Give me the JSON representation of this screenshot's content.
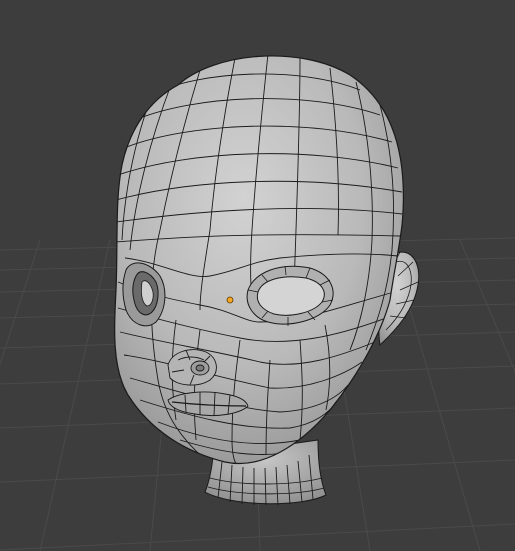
{
  "viewport": {
    "name": "3D Viewport",
    "background_color": "#3d3d3d",
    "grid_color": "#4a4a4a"
  },
  "object": {
    "name": "head-mesh",
    "display": "wireframe-overlay",
    "surface_color": "#bdbdbd",
    "edge_color": "#1a1a1a"
  },
  "origin_point": {
    "color": "#f5a623"
  }
}
